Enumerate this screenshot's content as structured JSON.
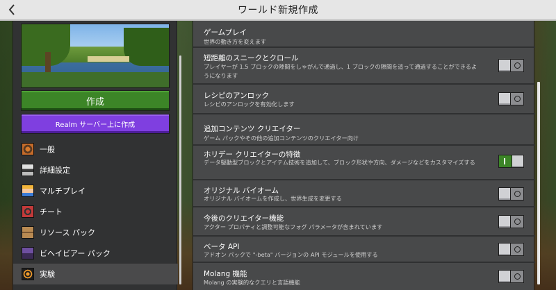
{
  "window": {
    "title": "ワールド新規作成"
  },
  "left": {
    "create_label": "作成",
    "realm_label": "Realm サーバー上に作成",
    "nav": [
      {
        "label": "一般",
        "icon": "gear-block-icon"
      },
      {
        "label": "詳細設定",
        "icon": "advanced-icon"
      },
      {
        "label": "マルチプレイ",
        "icon": "multiplayer-icon"
      },
      {
        "label": "チート",
        "icon": "cheat-icon"
      },
      {
        "label": "リソース パック",
        "icon": "resource-pack-icon"
      },
      {
        "label": "ビヘイビアー パック",
        "icon": "behavior-pack-icon"
      },
      {
        "label": "実験",
        "icon": "experiments-icon",
        "active": true
      }
    ]
  },
  "settings": [
    {
      "title": "ゲームプレイ",
      "desc": "世界の動き方を変えます"
    },
    {
      "title": "短距離のスニークとクロール",
      "desc": "プレイヤーが 1.5 ブロックの隙間をしゃがんで通過し、1 ブロックの隙間を這って通過することができるようになります",
      "toggle": "off"
    },
    {
      "title": "レシピのアンロック",
      "desc": "レシピのアンロックを有効化します",
      "toggle": "off"
    },
    {
      "title": "追加コンテンツ クリエイター",
      "desc": "ゲーム パックやその他の追加コンテンツのクリエイター向け"
    },
    {
      "title": "ホリデー クリエイターの特徴",
      "desc": "データ駆動型ブロックとアイテム技術を追加して、ブロック形状や方向、ダメージなどをカスタマイズする",
      "toggle": "on"
    },
    {
      "title": "オリジナル バイオーム",
      "desc": "オリジナル バイオームを作成し、世界生成を変更する",
      "toggle": "off"
    },
    {
      "title": "今後のクリエイター機能",
      "desc": "アクター プロパティと調整可能なフォグ パラメータが含まれています",
      "toggle": "off"
    },
    {
      "title": "ベータ API",
      "desc": "アドオン パックで \"-beta\" バージョンの API モジュールを使用する",
      "toggle": "off"
    },
    {
      "title": "Molang 機能",
      "desc": "Molang の実験的なクエリと言語機能",
      "toggle": "off"
    }
  ],
  "colors": {
    "create": "#3c8527",
    "realm": "#7f3fe0",
    "toggle_on": "#3c8527",
    "toggle_off": "#8c8d90"
  }
}
